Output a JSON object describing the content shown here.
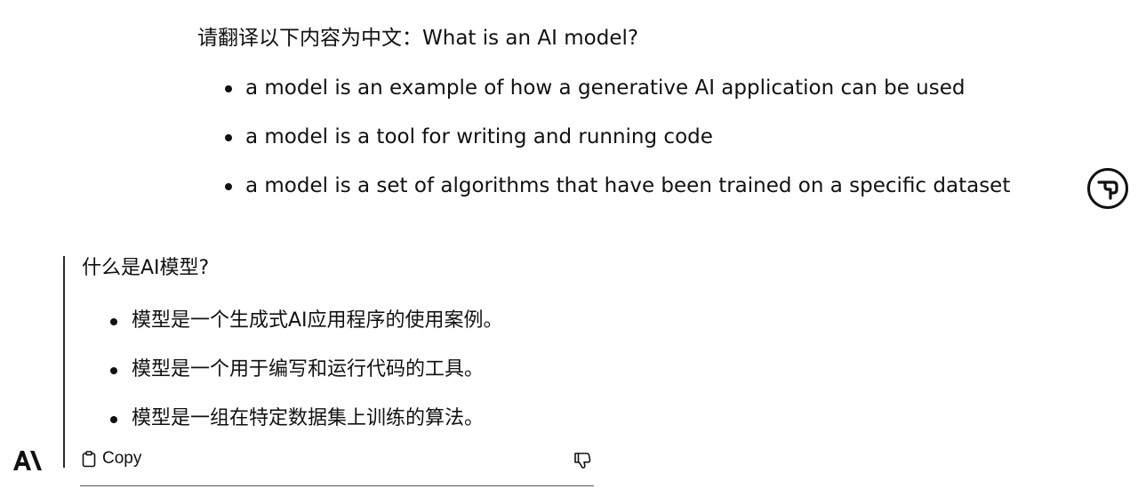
{
  "user_message": {
    "prompt": "请翻译以下内容为中文：What is an AI model?",
    "items": [
      {
        "text": "a model is an example of how a generative AI application can be used"
      },
      {
        "text": "a model is a tool for writing and running code"
      },
      {
        "text": "a model is a set of algorithms that have been trained on a specific dataset"
      }
    ],
    "avatar_icon": "user-avatar-icon"
  },
  "assistant_message": {
    "title": "什么是AI模型?",
    "items": [
      {
        "text": "模型是一个生成式AI应用程序的使用案例。"
      },
      {
        "text": "模型是一个用于编写和运行代码的工具。"
      },
      {
        "text": "模型是一组在特定数据集上训练的算法。"
      }
    ]
  },
  "actions": {
    "copy_label": "Copy",
    "copy_icon": "clipboard-icon",
    "feedback_icon": "thumbs-down-icon"
  },
  "brand": {
    "logo_icon": "anthropic-logo-icon"
  },
  "colors": {
    "text": "#111111",
    "background": "#ffffff",
    "accent_bar": "#2a2a2a"
  }
}
